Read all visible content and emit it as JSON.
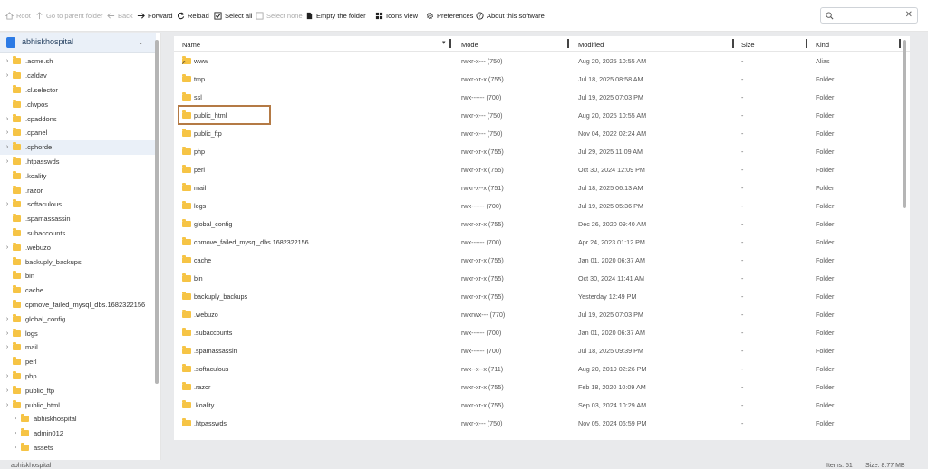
{
  "toolbar": {
    "root": "Root",
    "parent": "Go to parent folder",
    "back": "Back",
    "forward": "Forward",
    "reload": "Reload",
    "select_all": "Select all",
    "select_none": "Select none",
    "empty": "Empty the folder",
    "icons_view": "Icons view",
    "preferences": "Preferences",
    "about": "About this software"
  },
  "search": {
    "placeholder": ""
  },
  "sidebar": {
    "title": "abhiskhospital",
    "items": [
      {
        "label": ".acme.sh",
        "arrow": "›"
      },
      {
        "label": ".caldav",
        "arrow": "›"
      },
      {
        "label": ".cl.selector",
        "arrow": ""
      },
      {
        "label": ".clwpos",
        "arrow": ""
      },
      {
        "label": ".cpaddons",
        "arrow": "›"
      },
      {
        "label": ".cpanel",
        "arrow": "›"
      },
      {
        "label": ".cphorde",
        "arrow": "›"
      },
      {
        "label": ".htpasswds",
        "arrow": "›"
      },
      {
        "label": ".koality",
        "arrow": ""
      },
      {
        "label": ".razor",
        "arrow": ""
      },
      {
        "label": ".softaculous",
        "arrow": "›"
      },
      {
        "label": ".spamassassin",
        "arrow": ""
      },
      {
        "label": ".subaccounts",
        "arrow": ""
      },
      {
        "label": ".webuzo",
        "arrow": "›"
      },
      {
        "label": "backuply_backups",
        "arrow": ""
      },
      {
        "label": "bin",
        "arrow": ""
      },
      {
        "label": "cache",
        "arrow": ""
      },
      {
        "label": "cpmove_failed_mysql_dbs.1682322156",
        "arrow": ""
      },
      {
        "label": "global_config",
        "arrow": "›"
      },
      {
        "label": "logs",
        "arrow": "›"
      },
      {
        "label": "mail",
        "arrow": "›"
      },
      {
        "label": "perl",
        "arrow": ""
      },
      {
        "label": "php",
        "arrow": "›"
      },
      {
        "label": "public_ftp",
        "arrow": "›"
      },
      {
        "label": "public_html",
        "arrow": "›"
      },
      {
        "label": "abhiskhospital",
        "arrow": "›",
        "indent": 1
      },
      {
        "label": "admin012",
        "arrow": "›",
        "indent": 1
      },
      {
        "label": "assets",
        "arrow": "›",
        "indent": 1
      }
    ]
  },
  "columns": {
    "name": "Name",
    "mode": "Mode",
    "modified": "Modified",
    "size": "Size",
    "kind": "Kind"
  },
  "files": [
    {
      "name": "www",
      "mode": "rwxr-x--- (750)",
      "modified": "Aug 20, 2025 10:55 AM",
      "size": "-",
      "kind": "Alias",
      "alias": true
    },
    {
      "name": "tmp",
      "mode": "rwxr-xr-x (755)",
      "modified": "Jul 18, 2025 08:58 AM",
      "size": "-",
      "kind": "Folder"
    },
    {
      "name": "ssl",
      "mode": "rwx------ (700)",
      "modified": "Jul 19, 2025 07:03 PM",
      "size": "-",
      "kind": "Folder"
    },
    {
      "name": "public_html",
      "mode": "rwxr-x--- (750)",
      "modified": "Aug 20, 2025 10:55 AM",
      "size": "-",
      "kind": "Folder"
    },
    {
      "name": "public_ftp",
      "mode": "rwxr-x--- (750)",
      "modified": "Nov 04, 2022 02:24 AM",
      "size": "-",
      "kind": "Folder"
    },
    {
      "name": "php",
      "mode": "rwxr-xr-x (755)",
      "modified": "Jul 29, 2025 11:09 AM",
      "size": "-",
      "kind": "Folder"
    },
    {
      "name": "perl",
      "mode": "rwxr-xr-x (755)",
      "modified": "Oct 30, 2024 12:09 PM",
      "size": "-",
      "kind": "Folder"
    },
    {
      "name": "mail",
      "mode": "rwxr-x--x (751)",
      "modified": "Jul 18, 2025 06:13 AM",
      "size": "-",
      "kind": "Folder"
    },
    {
      "name": "logs",
      "mode": "rwx------ (700)",
      "modified": "Jul 19, 2025 05:36 PM",
      "size": "-",
      "kind": "Folder"
    },
    {
      "name": "global_config",
      "mode": "rwxr-xr-x (755)",
      "modified": "Dec 26, 2020 09:40 AM",
      "size": "-",
      "kind": "Folder"
    },
    {
      "name": "cpmove_failed_mysql_dbs.1682322156",
      "mode": "rwx------ (700)",
      "modified": "Apr 24, 2023 01:12 PM",
      "size": "-",
      "kind": "Folder"
    },
    {
      "name": "cache",
      "mode": "rwxr-xr-x (755)",
      "modified": "Jan 01, 2020 06:37 AM",
      "size": "-",
      "kind": "Folder"
    },
    {
      "name": "bin",
      "mode": "rwxr-xr-x (755)",
      "modified": "Oct 30, 2024 11:41 AM",
      "size": "-",
      "kind": "Folder"
    },
    {
      "name": "backuply_backups",
      "mode": "rwxr-xr-x (755)",
      "modified": "Yesterday 12:49 PM",
      "size": "-",
      "kind": "Folder"
    },
    {
      "name": ".webuzo",
      "mode": "rwxrwx--- (770)",
      "modified": "Jul 19, 2025 07:03 PM",
      "size": "-",
      "kind": "Folder"
    },
    {
      "name": ".subaccounts",
      "mode": "rwx------ (700)",
      "modified": "Jan 01, 2020 06:37 AM",
      "size": "-",
      "kind": "Folder"
    },
    {
      "name": ".spamassassin",
      "mode": "rwx------ (700)",
      "modified": "Jul 18, 2025 09:39 PM",
      "size": "-",
      "kind": "Folder"
    },
    {
      "name": ".softaculous",
      "mode": "rwx--x--x (711)",
      "modified": "Aug 20, 2019 02:26 PM",
      "size": "-",
      "kind": "Folder"
    },
    {
      "name": ".razor",
      "mode": "rwxr-xr-x (755)",
      "modified": "Feb 18, 2020 10:09 AM",
      "size": "-",
      "kind": "Folder"
    },
    {
      "name": ".koality",
      "mode": "rwxr-xr-x (755)",
      "modified": "Sep 03, 2024 10:29 AM",
      "size": "-",
      "kind": "Folder"
    },
    {
      "name": ".htpasswds",
      "mode": "rwxr-x--- (750)",
      "modified": "Nov 05, 2024 06:59 PM",
      "size": "-",
      "kind": "Folder"
    }
  ],
  "status": {
    "left": "abhiskhospital",
    "items": "Items: 51",
    "size": "Size: 8.77 MB"
  },
  "colors": {
    "folder": "#f6c445",
    "highlight": "#b47a45",
    "selected": "#eaf0f8"
  }
}
